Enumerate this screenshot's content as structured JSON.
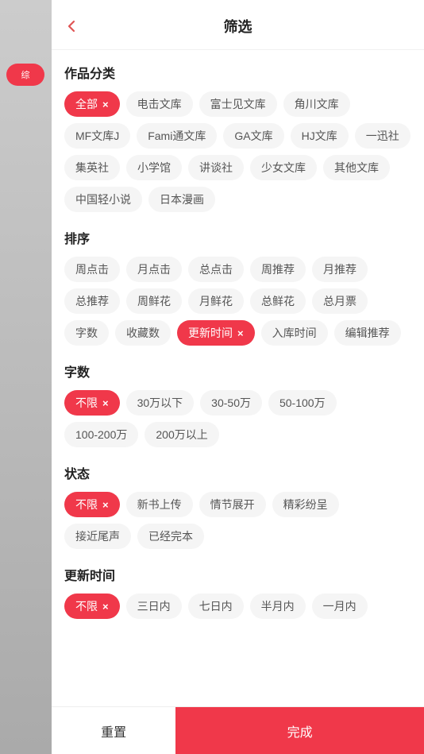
{
  "header": {
    "title": "筛选",
    "back_icon": "‹"
  },
  "sections": [
    {
      "id": "category",
      "title": "作品分类",
      "tags": [
        {
          "label": "全部",
          "active": true,
          "closeable": true
        },
        {
          "label": "电击文库",
          "active": false
        },
        {
          "label": "富士见文库",
          "active": false
        },
        {
          "label": "角川文库",
          "active": false
        },
        {
          "label": "MF文库J",
          "active": false
        },
        {
          "label": "Fami通文库",
          "active": false
        },
        {
          "label": "GA文库",
          "active": false
        },
        {
          "label": "HJ文库",
          "active": false
        },
        {
          "label": "一迅社",
          "active": false
        },
        {
          "label": "集英社",
          "active": false
        },
        {
          "label": "小学馆",
          "active": false
        },
        {
          "label": "讲谈社",
          "active": false
        },
        {
          "label": "少女文库",
          "active": false
        },
        {
          "label": "其他文库",
          "active": false
        },
        {
          "label": "中国轻小说",
          "active": false
        },
        {
          "label": "日本漫画",
          "active": false
        }
      ]
    },
    {
      "id": "sort",
      "title": "排序",
      "tags": [
        {
          "label": "周点击",
          "active": false
        },
        {
          "label": "月点击",
          "active": false
        },
        {
          "label": "总点击",
          "active": false
        },
        {
          "label": "周推荐",
          "active": false
        },
        {
          "label": "月推荐",
          "active": false
        },
        {
          "label": "总推荐",
          "active": false
        },
        {
          "label": "周鲜花",
          "active": false
        },
        {
          "label": "月鲜花",
          "active": false
        },
        {
          "label": "总鲜花",
          "active": false
        },
        {
          "label": "总月票",
          "active": false
        },
        {
          "label": "字数",
          "active": false
        },
        {
          "label": "收藏数",
          "active": false
        },
        {
          "label": "更新时间",
          "active": true,
          "closeable": true
        },
        {
          "label": "入库时间",
          "active": false
        },
        {
          "label": "编辑推荐",
          "active": false
        }
      ]
    },
    {
      "id": "wordcount",
      "title": "字数",
      "tags": [
        {
          "label": "不限",
          "active": true,
          "closeable": true
        },
        {
          "label": "30万以下",
          "active": false
        },
        {
          "label": "30-50万",
          "active": false
        },
        {
          "label": "50-100万",
          "active": false
        },
        {
          "label": "100-200万",
          "active": false
        },
        {
          "label": "200万以上",
          "active": false
        }
      ]
    },
    {
      "id": "status",
      "title": "状态",
      "tags": [
        {
          "label": "不限",
          "active": true,
          "closeable": true
        },
        {
          "label": "新书上传",
          "active": false
        },
        {
          "label": "情节展开",
          "active": false
        },
        {
          "label": "精彩纷呈",
          "active": false
        },
        {
          "label": "接近尾声",
          "active": false
        },
        {
          "label": "已经完本",
          "active": false
        }
      ]
    },
    {
      "id": "update_time",
      "title": "更新时间",
      "tags": [
        {
          "label": "不限",
          "active": true,
          "closeable": true
        },
        {
          "label": "三日内",
          "active": false
        },
        {
          "label": "七日内",
          "active": false
        },
        {
          "label": "半月内",
          "active": false
        },
        {
          "label": "一月内",
          "active": false
        }
      ]
    }
  ],
  "footer": {
    "reset_label": "重置",
    "confirm_label": "完成"
  },
  "sidebar": {
    "pill_label": "综"
  }
}
